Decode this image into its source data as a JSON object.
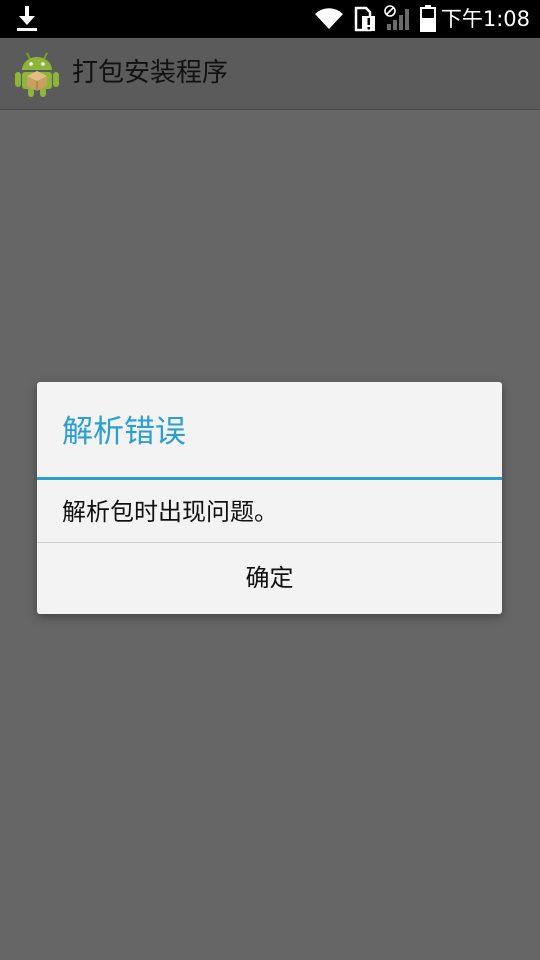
{
  "status_bar": {
    "time": "下午1:08",
    "icons": [
      "download-icon",
      "wifi-icon",
      "sim-alert-icon",
      "signal-off-icon",
      "battery-icon"
    ]
  },
  "action_bar": {
    "title": "打包安装程序",
    "icon": "android-robot-icon"
  },
  "dialog": {
    "title": "解析错误",
    "message": "解析包时出现问题。",
    "ok_button": "确定"
  },
  "colors": {
    "accent": "#2a9fd0",
    "background_dim": "#666666",
    "dialog_bg": "#f3f3f3",
    "status_bar": "#000000"
  }
}
